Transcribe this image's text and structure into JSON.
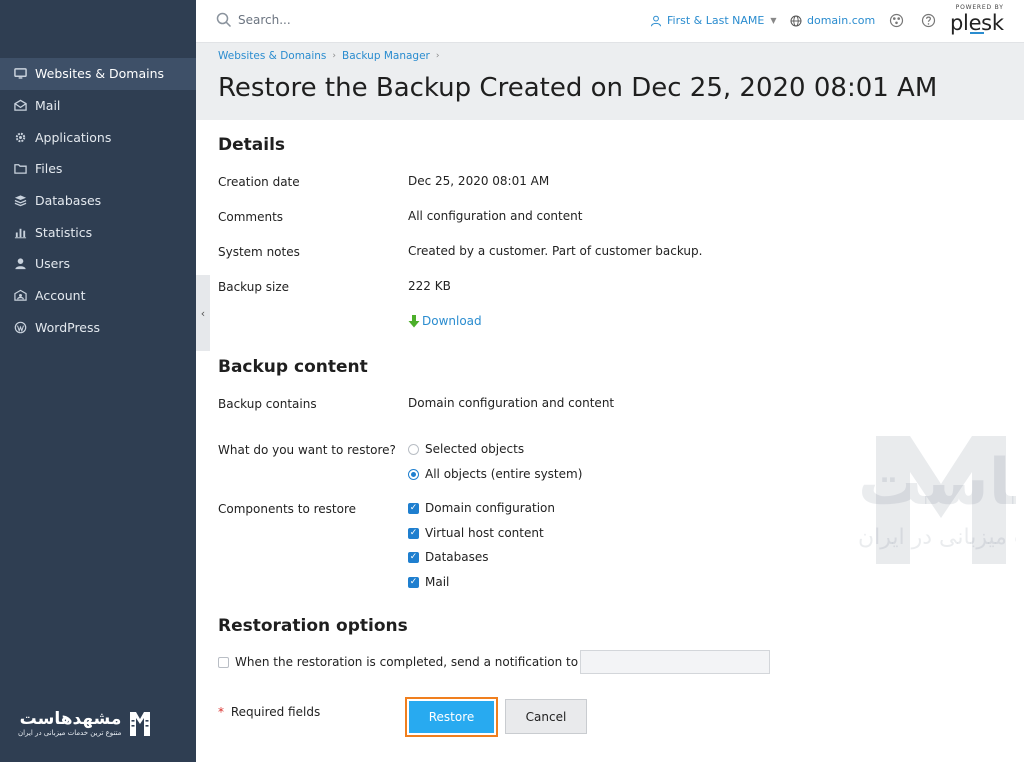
{
  "sidebar": {
    "items": [
      {
        "label": "Websites & Domains",
        "icon": "monitor-icon",
        "active": true
      },
      {
        "label": "Mail",
        "icon": "mail-icon"
      },
      {
        "label": "Applications",
        "icon": "gear-icon"
      },
      {
        "label": "Files",
        "icon": "folder-icon"
      },
      {
        "label": "Databases",
        "icon": "database-icon"
      },
      {
        "label": "Statistics",
        "icon": "bar-chart-icon"
      },
      {
        "label": "Users",
        "icon": "user-icon"
      },
      {
        "label": "Account",
        "icon": "account-icon"
      },
      {
        "label": "WordPress",
        "icon": "wordpress-icon"
      }
    ],
    "logo": {
      "name": "مشهدهاست",
      "tagline": "متنوع ترین خدمات میزبانی در ایران"
    }
  },
  "header": {
    "search_placeholder": "Search...",
    "user_name": "First & Last NAME",
    "domain": "domain.com",
    "brand_small": "POWERED BY",
    "brand": "plesk"
  },
  "breadcrumb": [
    "Websites & Domains",
    "Backup Manager"
  ],
  "page_title": "Restore the Backup Created on Dec 25, 2020 08:01 AM",
  "details": {
    "heading": "Details",
    "rows": [
      {
        "label": "Creation date",
        "value": "Dec 25, 2020 08:01 AM"
      },
      {
        "label": "Comments",
        "value": "All configuration and content"
      },
      {
        "label": "System notes",
        "value": "Created by a customer. Part of customer backup."
      },
      {
        "label": "Backup size",
        "value": "222 KB"
      }
    ],
    "download_label": "Download"
  },
  "backup_content": {
    "heading": "Backup content",
    "contains_label": "Backup contains",
    "contains_value": "Domain configuration and content",
    "restore_label": "What do you want to restore?",
    "restore_options": [
      {
        "label": "Selected objects",
        "selected": false
      },
      {
        "label": "All objects (entire system)",
        "selected": true
      }
    ],
    "components_label": "Components to restore",
    "components": [
      {
        "label": "Domain configuration",
        "checked": true
      },
      {
        "label": "Virtual host content",
        "checked": true
      },
      {
        "label": "Databases",
        "checked": true
      },
      {
        "label": "Mail",
        "checked": true
      }
    ]
  },
  "restoration": {
    "heading": "Restoration options",
    "notify_label": "When the restoration is completed, send a notification to",
    "notify_value": "",
    "notify_checked": false
  },
  "footer": {
    "required_star": "*",
    "required_label": "Required fields",
    "restore_button": "Restore",
    "cancel_button": "Cancel"
  },
  "watermark": {
    "name": "مشهدهاست",
    "tagline": "متنوع ترین خدمات میزبانی در ایران"
  },
  "colors": {
    "sidebar_bg": "#2f3e52",
    "sidebar_active": "#3e5068",
    "link": "#2a8ccf",
    "primary_button": "#28aaf0",
    "highlight_border": "#f07f1e",
    "download_arrow": "#4caf2a"
  }
}
